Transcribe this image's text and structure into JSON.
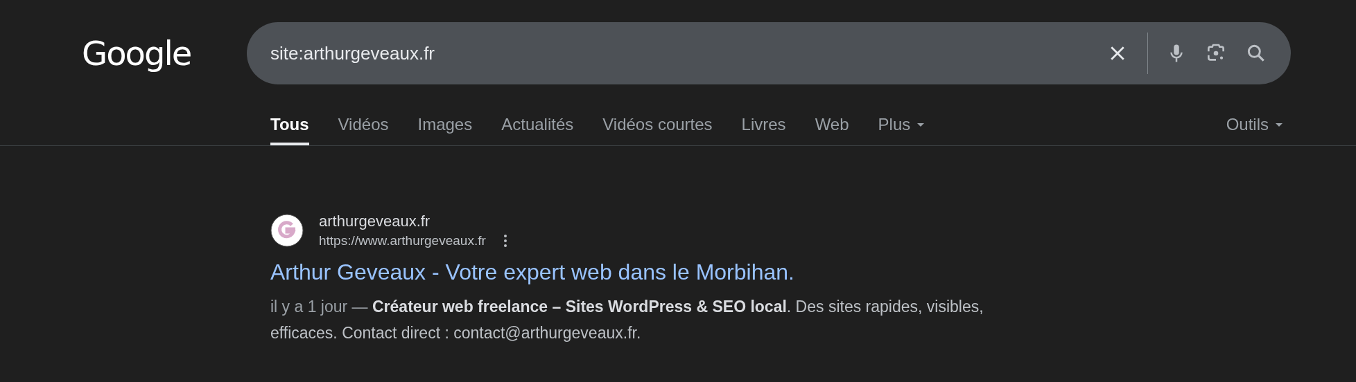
{
  "logo": "Google",
  "search": {
    "value": "site:arthurgeveaux.fr"
  },
  "tabs": [
    {
      "label": "Tous",
      "selected": true
    },
    {
      "label": "Vidéos",
      "selected": false
    },
    {
      "label": "Images",
      "selected": false
    },
    {
      "label": "Actualités",
      "selected": false
    },
    {
      "label": "Vidéos courtes",
      "selected": false
    },
    {
      "label": "Livres",
      "selected": false
    },
    {
      "label": "Web",
      "selected": false
    },
    {
      "label": "Plus",
      "selected": false,
      "dropdown": true
    }
  ],
  "tools": {
    "label": "Outils"
  },
  "results": [
    {
      "site_name": "arthurgeveaux.fr",
      "url": "https://www.arthurgeveaux.fr",
      "title": "Arthur Geveaux - Votre expert web dans le Morbihan.",
      "date": "il y a 1 jour —",
      "snippet": "**Créateur web freelance – Sites WordPress & SEO local**. Des sites rapides, visibles, efficaces. Contact direct : contact@arthurgeveaux.fr."
    }
  ]
}
